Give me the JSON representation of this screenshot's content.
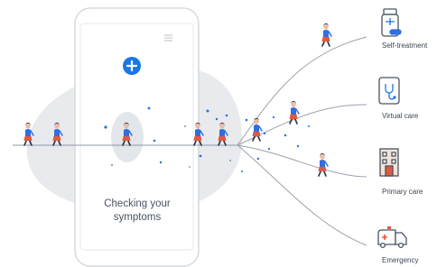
{
  "phone": {
    "headline_line1": "Checking your",
    "headline_line2": "symptoms",
    "icon": "plus-circle-icon",
    "menu_icon": "hamburger-menu-icon"
  },
  "destinations": [
    {
      "label": "Self-treatment",
      "icon": "medicine-bottle-icon"
    },
    {
      "label": "Virtual care",
      "icon": "stethoscope-tablet-icon"
    },
    {
      "label": "Primary care",
      "icon": "clinic-building-icon"
    },
    {
      "label": "Emergency",
      "icon": "ambulance-icon"
    }
  ],
  "colors": {
    "accent_blue": "#1877e6",
    "person_blue": "#2f6fe0",
    "person_red": "#e2583e",
    "skin": "#f2b9a3",
    "dark_navy": "#2b3442",
    "blob_gray": "#e6e8ec",
    "line_gray": "#9aa2ae",
    "icon_outline": "#4a5362"
  }
}
